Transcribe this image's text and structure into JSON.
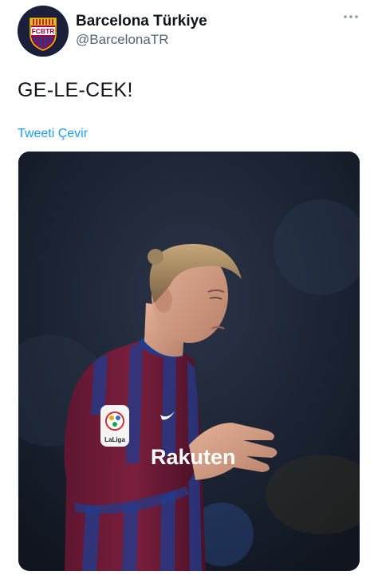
{
  "tweet": {
    "author": {
      "display_name": "Barcelona Türkiye",
      "handle": "@BarcelonaTR",
      "avatar_badge_text": "FCBTR",
      "avatar_icon": "fcb-crest-icon"
    },
    "more_icon": "more-dots-icon",
    "text": "GE-LE-CEK!",
    "translate_label": "Tweeti Çevir",
    "media": {
      "kind": "photo",
      "shirt_sponsor": "Rakuten",
      "league_patch": "LaLiga"
    }
  },
  "colors": {
    "link": "#1d9bf0",
    "secondary_text": "#536471",
    "primary_text": "#0f1419",
    "jersey_garnet": "#7a1f3d",
    "jersey_blue": "#1f3c8f"
  }
}
